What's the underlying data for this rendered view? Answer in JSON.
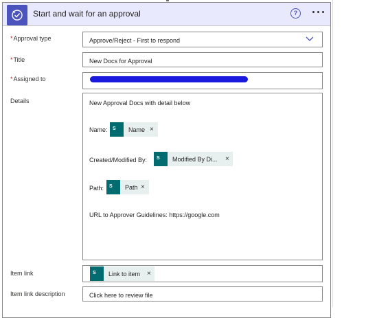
{
  "action": {
    "title": "Start and wait for an approval",
    "help_symbol": "?",
    "icon": "approval-icon",
    "more_icon": "ellipsis-icon",
    "header_color": "#e8e9fc",
    "accent": "#4b53bc"
  },
  "fields": {
    "approval_type": {
      "label": "Approval type",
      "required": "*",
      "value": "Approve/Reject - First to respond"
    },
    "title": {
      "label": "Title",
      "required": "*",
      "value": "New Docs for Approval"
    },
    "assigned_to": {
      "label": "Assigned to",
      "required": "*"
    },
    "details": {
      "label": "Details",
      "line1": "New Approval Docs with detail below",
      "name_prefix": "Name:",
      "name_token": "Name",
      "created_prefix": "Created/Modified By:",
      "created_token": "Modified By Di...",
      "path_prefix": "Path:",
      "path_token": "Path",
      "url_line": "URL to Approver Guidelines: https://google.com"
    },
    "item_link": {
      "label": "Item link",
      "token": "Link to item"
    },
    "item_link_description": {
      "label": "Item link description",
      "value": "Click here to review file"
    }
  },
  "token_icon_text": "S",
  "close_symbol": "×"
}
